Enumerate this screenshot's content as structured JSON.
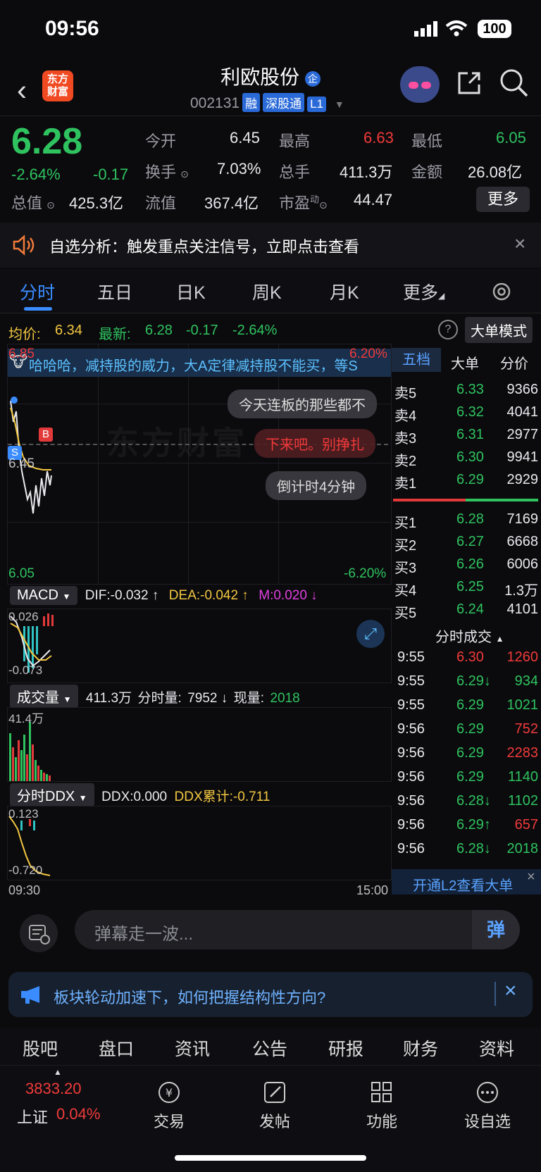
{
  "status_bar": {
    "time": "09:56",
    "battery": "100"
  },
  "header": {
    "logo_line1": "东方",
    "logo_line2": "财富",
    "stock_name": "利欧股份",
    "badge": "企",
    "stock_code": "002131",
    "tags": [
      "融",
      "深股通",
      "L1"
    ]
  },
  "quote": {
    "price": "6.28",
    "change_pct": "-2.64%",
    "change": "-0.17",
    "open_label": "今开",
    "open_value": "6.45",
    "high_label": "最高",
    "high_value": "6.63",
    "low_label": "最低",
    "low_value": "6.05",
    "turnover_label": "换手",
    "turnover_value": "7.03%",
    "volume_label": "总手",
    "volume_value": "411.3万",
    "amount_label": "金额",
    "amount_value": "26.08亿",
    "mktcap_label": "总值",
    "mktcap_value": "425.3亿",
    "float_label": "流值",
    "float_value": "367.4亿",
    "pe_label": "市盈",
    "pe_sup": "动",
    "pe_value": "44.47",
    "more_button": "更多"
  },
  "alert": {
    "text": "自选分析：触发重点关注信号，立即点击查看",
    "close": "×"
  },
  "tabs": [
    "分时",
    "五日",
    "日K",
    "周K",
    "月K",
    "更多"
  ],
  "avg_row": {
    "avg_label": "均价:",
    "avg_value": "6.34",
    "latest_label": "最新:",
    "latest_value": "6.28",
    "change": "-0.17",
    "change_pct": "-2.64%",
    "help": "?",
    "mode_button": "大单模式"
  },
  "chart": {
    "y_top": "6.85",
    "y_bottom": "6.05",
    "pct_top": "6.20%",
    "pct_bottom": "-6.20%",
    "ref_price": "6.45",
    "watermark": "东方财富",
    "marker_b": "B",
    "marker_s": "S",
    "danmu": [
      "哈哈哈，减持股的威力，大A定律减持股不能买，等S",
      "今天连板的那些都不",
      "下来吧。别挣扎",
      "倒计时4分钟"
    ]
  },
  "macd": {
    "label": "MACD",
    "dif": "DIF:-0.032 ↑",
    "dea": "DEA:-0.042 ↑",
    "m": "M:0.020 ↓",
    "top": "0.026",
    "bottom": "-0.073"
  },
  "volume": {
    "label": "成交量",
    "total": "411.3万",
    "tick_label": "分时量:",
    "tick_value": "7952 ↓",
    "now_label": "现量:",
    "now_value": "2018",
    "top": "41.4万"
  },
  "ddx": {
    "label": "分时DDX",
    "ddx": "DDX:0.000",
    "cum": "DDX累计:-0.711",
    "top": "0.123",
    "bottom": "-0.720"
  },
  "time_axis": {
    "start": "09:30",
    "end": "15:00"
  },
  "orderbook": {
    "tabs": [
      "五档",
      "大单",
      "分价"
    ],
    "asks": [
      {
        "label": "卖5",
        "price": "6.33",
        "vol": "9366"
      },
      {
        "label": "卖4",
        "price": "6.32",
        "vol": "4041"
      },
      {
        "label": "卖3",
        "price": "6.31",
        "vol": "2977"
      },
      {
        "label": "卖2",
        "price": "6.30",
        "vol": "9941"
      },
      {
        "label": "卖1",
        "price": "6.29",
        "vol": "2929"
      }
    ],
    "bids": [
      {
        "label": "买1",
        "price": "6.28",
        "vol": "7169"
      },
      {
        "label": "买2",
        "price": "6.27",
        "vol": "6668"
      },
      {
        "label": "买3",
        "price": "6.26",
        "vol": "6006"
      },
      {
        "label": "买4",
        "price": "6.25",
        "vol": "1.3万"
      },
      {
        "label": "买5",
        "price": "6.24",
        "vol": "4101"
      }
    ],
    "trades_title": "分时成交",
    "trades": [
      {
        "time": "9:55",
        "price": "6.30",
        "vol": "1260"
      },
      {
        "time": "9:55",
        "price": "6.29↓",
        "vol": "934"
      },
      {
        "time": "9:55",
        "price": "6.29",
        "vol": "1021"
      },
      {
        "time": "9:56",
        "price": "6.29",
        "vol": "752"
      },
      {
        "time": "9:56",
        "price": "6.29",
        "vol": "2283"
      },
      {
        "time": "9:56",
        "price": "6.29",
        "vol": "1140"
      },
      {
        "time": "9:56",
        "price": "6.28↓",
        "vol": "1102"
      },
      {
        "time": "9:56",
        "price": "6.29↑",
        "vol": "657"
      },
      {
        "time": "9:56",
        "price": "6.28↓",
        "vol": "2018"
      }
    ],
    "l2_text": "开通L2查看大单"
  },
  "input": {
    "placeholder": "弹幕走一波...",
    "send": "弹"
  },
  "banner": {
    "text": "板块轮动加速下，如何把握结构性方向?",
    "close": "×"
  },
  "bottom_tabs": [
    "股吧",
    "盘口",
    "资讯",
    "公告",
    "研报",
    "财务",
    "资料"
  ],
  "index": {
    "value": "3833.20",
    "name": "上证",
    "pct": "0.04%"
  },
  "nav": [
    "交易",
    "发帖",
    "功能",
    "设自选"
  ]
}
